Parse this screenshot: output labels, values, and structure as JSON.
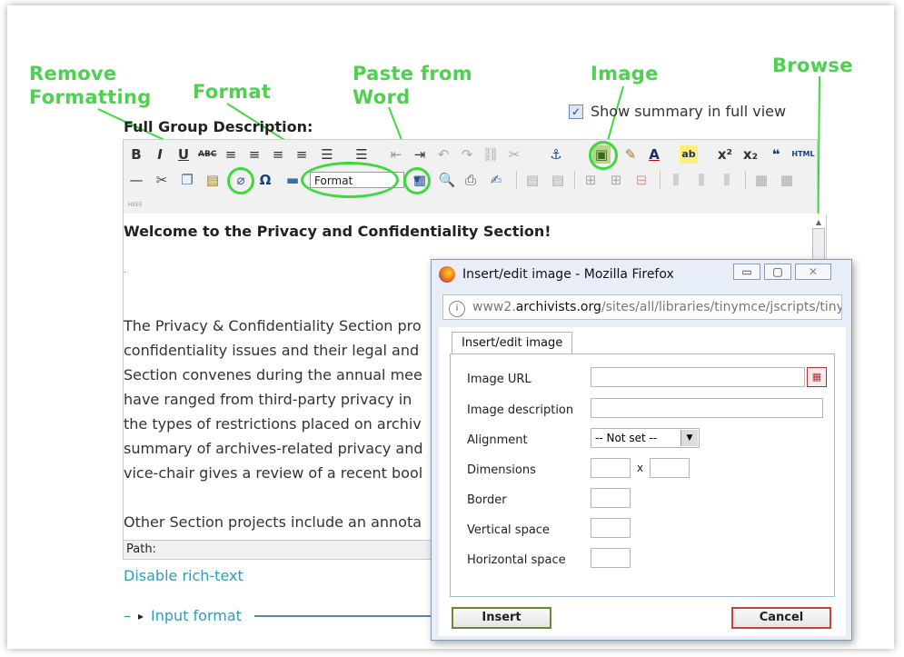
{
  "annotations": {
    "remove_formatting": "Remove\nFormatting",
    "format": "Format",
    "paste_from_word": "Paste from\nWord",
    "image": "Image",
    "browse": "Browse"
  },
  "editor": {
    "label": "Full Group Description:",
    "summary_label": "Show summary in full view",
    "summary_checked": true,
    "format_select": "Format",
    "content": {
      "heading": "Welcome to the Privacy and Confidentiality Section!",
      "lines": [
        "The Privacy & Confidentiality Section pro",
        "confidentiality issues and their legal and",
        "Section convenes during the annual mee",
        "have ranged from third-party privacy in",
        "the types of restrictions placed on archiv",
        "summary of archives-related privacy and",
        "vice-chair gives a review of a recent bool"
      ],
      "last_line": "Other Section projects include an annota"
    },
    "path_label": "Path:",
    "disable_link": "Disable rich-text",
    "input_format_dash": "–",
    "input_format_arrow": "▸",
    "input_format_link": "Input format"
  },
  "toolbar": {
    "row1": [
      "B",
      "I",
      "U",
      "ABC",
      "≡",
      "≡",
      "≡",
      "≡",
      "☰",
      "☰",
      "⇤",
      "⇥",
      "↶",
      "↷",
      "⛓",
      "⛓",
      "⚓",
      "▣",
      "✎",
      "A",
      "ab",
      "x²",
      "x₂",
      "❝",
      "HTML"
    ],
    "row3_label": "HEEE"
  },
  "dialog": {
    "window_title": "Insert/edit image - Mozilla Firefox",
    "url_prefix": "www2.",
    "url_domain": "archivists.org",
    "url_path": "/sites/all/libraries/tinymce/jscripts/tiny",
    "tab_label": "Insert/edit image",
    "fields": {
      "image_url": "Image URL",
      "image_description": "Image description",
      "alignment": "Alignment",
      "alignment_value": "-- Not set --",
      "dimensions": "Dimensions",
      "dimensions_x": "x",
      "border": "Border",
      "vertical_space": "Vertical space",
      "horizontal_space": "Horizontal space"
    },
    "insert_label": "Insert",
    "cancel_label": "Cancel"
  },
  "colors": {
    "annotation": "#4ed14e",
    "link": "#2b9fb3",
    "insert_border": "#6b8a2a",
    "cancel_border": "#c8423a"
  }
}
